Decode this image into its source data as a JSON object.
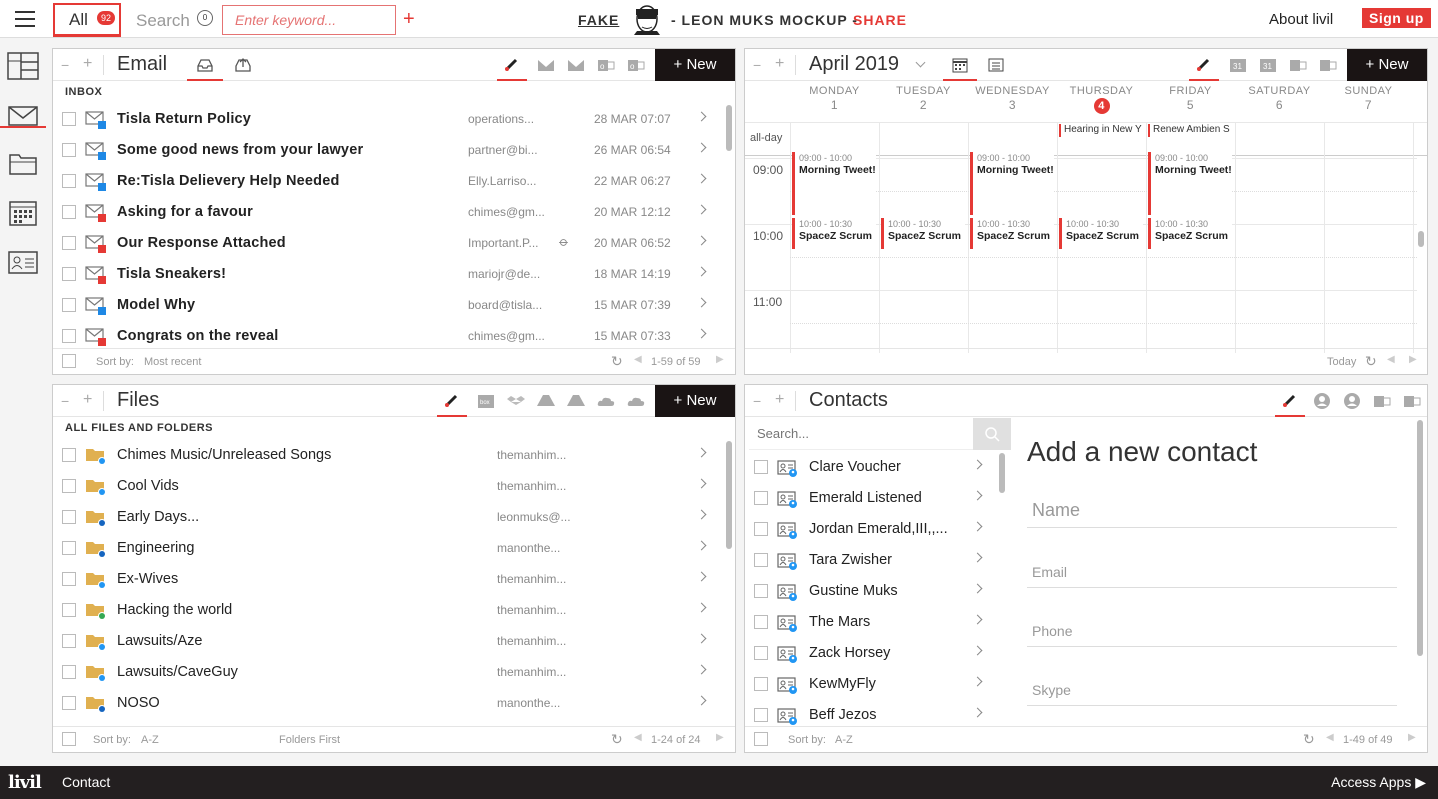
{
  "topbar": {
    "all_label": "All",
    "all_count": "92",
    "search_label": "Search",
    "search_count": "0",
    "keyword_placeholder": "Enter keyword...",
    "fake_label": "FAKE",
    "mockup_label": "- LEON MUKS MOCKUP -",
    "share_label": "SHARE",
    "about_label": "About livil",
    "signup_label": "Sign up"
  },
  "sidebar": {
    "items": [
      "layout-icon",
      "mail-icon",
      "folder-icon",
      "calendar-icon",
      "contact-card-icon"
    ]
  },
  "email": {
    "title": "Email",
    "new_label": "+ New",
    "section": "INBOX",
    "sort_label": "Sort by:",
    "sort_value": "Most recent",
    "pagination": "1-59 of 59",
    "rows": [
      {
        "subject": "Tisla Return Policy",
        "from": "operations...",
        "date": "28 MAR 07:07",
        "provider": "outlook",
        "attach": false
      },
      {
        "subject": "Some good news from your lawyer",
        "from": "partner@bi...",
        "date": "26 MAR 06:54",
        "provider": "outlook",
        "attach": false
      },
      {
        "subject": "Re:Tisla Delievery Help Needed",
        "from": "Elly.Larriso...",
        "date": "22 MAR 06:27",
        "provider": "outlook",
        "attach": false
      },
      {
        "subject": "Asking for a favour",
        "from": "chimes@gm...",
        "date": "20 MAR 12:12",
        "provider": "gmail",
        "attach": false
      },
      {
        "subject": "Our Response Attached",
        "from": "Important.P...",
        "date": "20 MAR 06:52",
        "provider": "gmail",
        "attach": true
      },
      {
        "subject": "Tisla Sneakers!",
        "from": "mariojr@de...",
        "date": "18 MAR 14:19",
        "provider": "gmail",
        "attach": false
      },
      {
        "subject": "Model Why",
        "from": "board@tisla...",
        "date": "15 MAR 07:39",
        "provider": "outlook",
        "attach": false
      },
      {
        "subject": "Congrats on the reveal",
        "from": "chimes@gm...",
        "date": "15 MAR 07:33",
        "provider": "gmail",
        "attach": false
      }
    ]
  },
  "calendar": {
    "title": "April 2019",
    "new_label": "+ New",
    "today_label": "Today",
    "allday_label": "all-day",
    "days": [
      {
        "name": "MONDAY",
        "num": "1"
      },
      {
        "name": "TUESDAY",
        "num": "2"
      },
      {
        "name": "WEDNESDAY",
        "num": "3"
      },
      {
        "name": "THURSDAY",
        "num": "4"
      },
      {
        "name": "FRIDAY",
        "num": "5"
      },
      {
        "name": "SATURDAY",
        "num": "6"
      },
      {
        "name": "SUNDAY",
        "num": "7"
      }
    ],
    "today_index": 3,
    "times": [
      "09:00",
      "10:00",
      "11:00"
    ],
    "allday_events": [
      {
        "day": 3,
        "title": "Hearing in New Y"
      },
      {
        "day": 4,
        "title": "Renew Ambien S"
      }
    ],
    "events": [
      {
        "day": 0,
        "time": "09:00 - 10:00",
        "title": "Morning Tweet!",
        "slot": "9"
      },
      {
        "day": 2,
        "time": "09:00 - 10:00",
        "title": "Morning Tweet!",
        "slot": "9"
      },
      {
        "day": 4,
        "time": "09:00 - 10:00",
        "title": "Morning Tweet!",
        "slot": "9"
      },
      {
        "day": 0,
        "time": "10:00 - 10:30",
        "title": "SpaceZ Scrum",
        "slot": "10"
      },
      {
        "day": 1,
        "time": "10:00 - 10:30",
        "title": "SpaceZ Scrum",
        "slot": "10"
      },
      {
        "day": 2,
        "time": "10:00 - 10:30",
        "title": "SpaceZ Scrum",
        "slot": "10"
      },
      {
        "day": 3,
        "time": "10:00 - 10:30",
        "title": "SpaceZ Scrum",
        "slot": "10"
      },
      {
        "day": 4,
        "time": "10:00 - 10:30",
        "title": "SpaceZ Scrum",
        "slot": "10"
      }
    ]
  },
  "files": {
    "title": "Files",
    "new_label": "+ New",
    "section": "ALL FILES AND FOLDERS",
    "sort_label": "Sort by:",
    "sort_value": "A-Z",
    "folders_first": "Folders First",
    "pagination": "1-24 of 24",
    "rows": [
      {
        "name": "Chimes Music/Unreleased Songs",
        "owner": "themanhim...",
        "provider": "dropbox"
      },
      {
        "name": "Cool Vids",
        "owner": "themanhim...",
        "provider": "box"
      },
      {
        "name": "Early Days...",
        "owner": "leonmuks@...",
        "provider": "onedrive"
      },
      {
        "name": "Engineering",
        "owner": "manonthe...",
        "provider": "onedrive"
      },
      {
        "name": "Ex-Wives",
        "owner": "themanhim...",
        "provider": "box"
      },
      {
        "name": "Hacking the world",
        "owner": "themanhim...",
        "provider": "gdrive"
      },
      {
        "name": "Lawsuits/Aze",
        "owner": "themanhim...",
        "provider": "box"
      },
      {
        "name": "Lawsuits/CaveGuy",
        "owner": "themanhim...",
        "provider": "box"
      },
      {
        "name": "NOSO",
        "owner": "manonthe...",
        "provider": "onedrive"
      }
    ]
  },
  "contacts": {
    "title": "Contacts",
    "search_placeholder": "Search...",
    "sort_label": "Sort by:",
    "sort_value": "A-Z",
    "pagination": "1-49 of 49",
    "rows": [
      "Clare Voucher",
      "Emerald Listened",
      "Jordan Emerald,III,,...",
      "Tara Zwisher",
      "Gustine Muks",
      "The Mars",
      "Zack Horsey",
      "KewMyFly",
      "Beff Jezos"
    ],
    "form": {
      "heading": "Add a new contact",
      "name_placeholder": "Name",
      "email_placeholder": "Email",
      "phone_placeholder": "Phone",
      "skype_placeholder": "Skype"
    }
  },
  "bottombar": {
    "logo": "livil",
    "contact_label": "Contact",
    "apps_label": "Access Apps"
  },
  "colors": {
    "accent": "#e53935",
    "dark": "#1a1414",
    "outlook": "#1e88e5",
    "gmail": "#e53935"
  }
}
